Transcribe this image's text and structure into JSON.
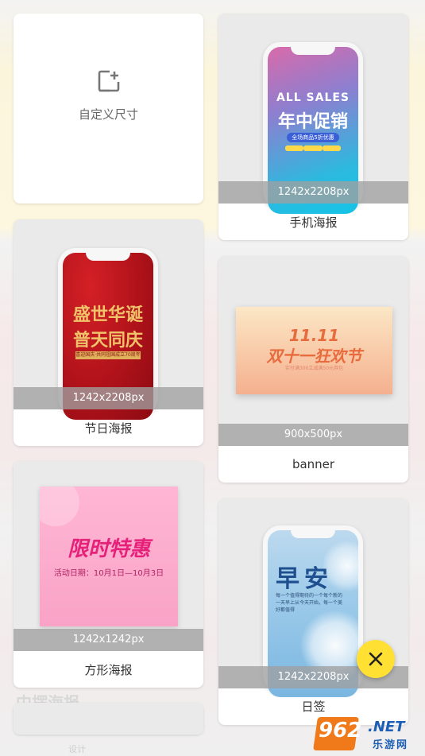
{
  "background": {
    "peek_title": "中摆海报",
    "peek_tab": "设计"
  },
  "custom_size": {
    "label": "自定义尺寸",
    "icon": "add-frame-icon"
  },
  "templates": [
    {
      "label": "手机海报",
      "size": "1242x2208px",
      "art": {
        "en": "ALL SALES",
        "cn": "年中促销",
        "pill": "全场商品5折优惠"
      }
    },
    {
      "label": "节日海报",
      "size": "1242x2208px",
      "art": {
        "line1": "盛世华诞",
        "line2": "普天同庆",
        "band": "喜迎国庆·共同祖国成立70周年"
      }
    },
    {
      "label": "banner",
      "size": "900x500px",
      "art": {
        "num": "11.11",
        "cn": "双十一狂欢节",
        "sub": "实付满300立减满50元券包"
      }
    },
    {
      "label": "方形海报",
      "size": "1242x1242px",
      "art": {
        "title": "限时特惠",
        "sub": "活动日期：10月1日—10月3日"
      }
    },
    {
      "label": "日签",
      "size": "1242x2208px",
      "art": {
        "title": "早安",
        "sub": "每一个值得期待的一个每个新的一天早上从今天开始，每一个美好都值得"
      }
    }
  ],
  "fab": {
    "icon": "close-icon"
  },
  "watermark": {
    "num": "962",
    "net": ".NET",
    "cn": "乐游网"
  },
  "colors": {
    "accent_yellow": "#ffe033",
    "watermark_orange": "#f07a1a",
    "watermark_blue": "#1d5fb4"
  }
}
